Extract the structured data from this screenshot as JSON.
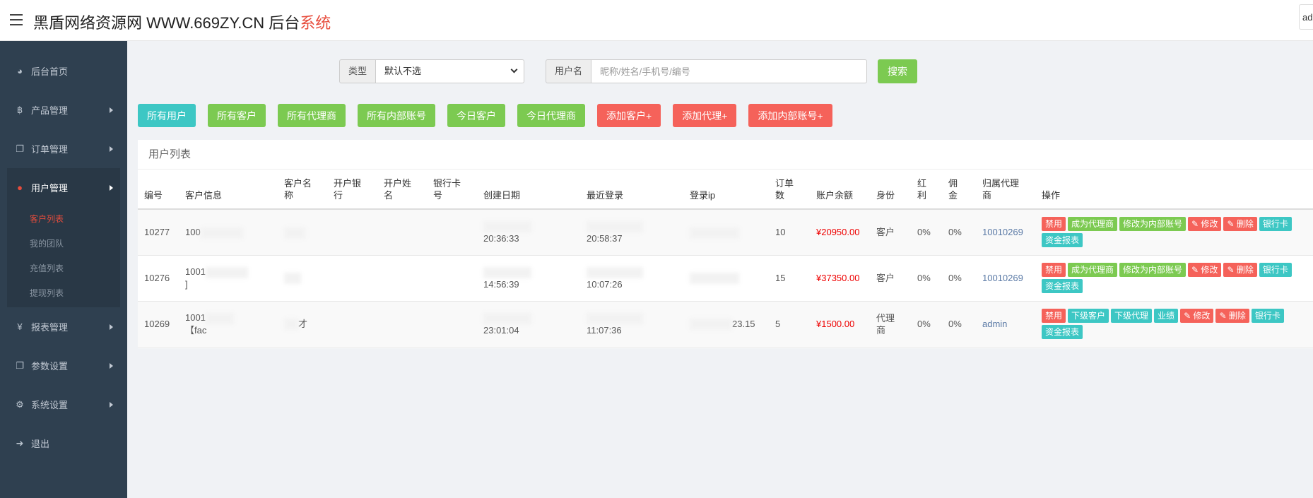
{
  "header": {
    "brand": "黑盾网络资源网 WWW.669ZY.CN 后台",
    "brand_red": "系统",
    "user": "ad"
  },
  "sidebar": {
    "items": [
      {
        "icon": "dashboard-icon",
        "glyph": "◕",
        "label": "后台首页",
        "arrow": false
      },
      {
        "icon": "bitcoin-icon",
        "glyph": "฿",
        "label": "产品管理",
        "arrow": true
      },
      {
        "icon": "copy-icon",
        "glyph": "❐",
        "label": "订单管理",
        "arrow": true
      }
    ],
    "group": {
      "icon": "user-icon",
      "glyph": "●",
      "label": "用户管理",
      "sub": [
        {
          "label": "客户列表",
          "active": true
        },
        {
          "label": "我的团队",
          "active": false
        },
        {
          "label": "充值列表",
          "active": false
        },
        {
          "label": "提现列表",
          "active": false
        }
      ]
    },
    "items_after": [
      {
        "icon": "yen-icon",
        "glyph": "¥",
        "label": "报表管理",
        "arrow": true
      },
      {
        "icon": "copy-icon",
        "glyph": "❐",
        "label": "参数设置",
        "arrow": true
      },
      {
        "icon": "cogs-icon",
        "glyph": "⚙",
        "label": "系统设置",
        "arrow": true
      },
      {
        "icon": "sign-out-icon",
        "glyph": "➜",
        "label": "退出",
        "arrow": false
      }
    ]
  },
  "search": {
    "type_label": "类型",
    "type_value": "默认不选",
    "user_label": "用户名",
    "user_placeholder": "昵称/姓名/手机号/编号",
    "button": "搜索"
  },
  "filters": [
    {
      "label": "所有用户",
      "color": "cyan"
    },
    {
      "label": "所有客户",
      "color": "green"
    },
    {
      "label": "所有代理商",
      "color": "green"
    },
    {
      "label": "所有内部账号",
      "color": "green"
    },
    {
      "label": "今日客户",
      "color": "green"
    },
    {
      "label": "今日代理商",
      "color": "green"
    },
    {
      "label": "添加客户+",
      "color": "red"
    },
    {
      "label": "添加代理+",
      "color": "red"
    },
    {
      "label": "添加内部账号+",
      "color": "red"
    }
  ],
  "panel": {
    "title": "用户列表",
    "columns": [
      "编号",
      "客户信息",
      "客户名称",
      "开户银行",
      "开户姓名",
      "银行卡号",
      "创建日期",
      "最近登录",
      "登录ip",
      "订单数",
      "账户余额",
      "身份",
      "红利",
      "佣金",
      "归属代理商",
      "操作"
    ],
    "rows": [
      {
        "id": "10277",
        "info_1": "100",
        "info_2": "",
        "name": "",
        "bank": "",
        "holder": "",
        "card": "",
        "created": "20:36:33",
        "last_login": "20:58:37",
        "ip": "",
        "orders": "10",
        "balance": "¥20950.00",
        "role": "客户",
        "bonus": "0%",
        "commission": "0%",
        "agent": "10010269",
        "ops": [
          {
            "label": "禁用",
            "color": "red",
            "icon": "ban-icon"
          },
          {
            "label": "成为代理商",
            "color": "green",
            "icon": "agent-icon"
          },
          {
            "label": "修改为内部账号",
            "color": "green",
            "icon": "internal-icon"
          },
          {
            "label": "✎ 修改",
            "color": "red",
            "icon": "pencil-icon"
          },
          {
            "label": "✎ 删除",
            "color": "red",
            "icon": "trash-icon"
          },
          {
            "label": "银行卡",
            "color": "cyan",
            "icon": "card-icon"
          },
          {
            "label": "资金报表",
            "color": "cyan",
            "icon": "report-icon"
          }
        ]
      },
      {
        "id": "10276",
        "info_1": "1001",
        "info_2": "]",
        "name": "",
        "bank": "",
        "holder": "",
        "card": "",
        "created": "14:56:39",
        "last_login": "10:07:26",
        "ip": "",
        "orders": "15",
        "balance": "¥37350.00",
        "role": "客户",
        "bonus": "0%",
        "commission": "0%",
        "agent": "10010269",
        "ops": [
          {
            "label": "禁用",
            "color": "red",
            "icon": "ban-icon"
          },
          {
            "label": "成为代理商",
            "color": "green",
            "icon": "agent-icon"
          },
          {
            "label": "修改为内部账号",
            "color": "green",
            "icon": "internal-icon"
          },
          {
            "label": "✎ 修改",
            "color": "red",
            "icon": "pencil-icon"
          },
          {
            "label": "✎ 删除",
            "color": "red",
            "icon": "trash-icon"
          },
          {
            "label": "银行卡",
            "color": "cyan",
            "icon": "card-icon"
          },
          {
            "label": "资金报表",
            "color": "cyan",
            "icon": "report-icon"
          }
        ]
      },
      {
        "id": "10269",
        "info_1": "1001",
        "info_2": "【fac",
        "name": "才",
        "bank": "",
        "holder": "",
        "card": "",
        "created": "23:01:04",
        "last_login": "11:07:36",
        "ip": "23.15",
        "orders": "5",
        "balance": "¥1500.00",
        "role": "代理商",
        "bonus": "0%",
        "commission": "0%",
        "agent": "admin",
        "ops": [
          {
            "label": "禁用",
            "color": "red",
            "icon": "ban-icon"
          },
          {
            "label": "下级客户",
            "color": "cyan",
            "icon": "sub-customer-icon"
          },
          {
            "label": "下级代理",
            "color": "cyan",
            "icon": "sub-agent-icon"
          },
          {
            "label": "业绩",
            "color": "cyan",
            "icon": "performance-icon"
          },
          {
            "label": "✎ 修改",
            "color": "red",
            "icon": "pencil-icon"
          },
          {
            "label": "✎ 删除",
            "color": "red",
            "icon": "trash-icon"
          },
          {
            "label": "银行卡",
            "color": "cyan",
            "icon": "card-icon"
          },
          {
            "label": "资金报表",
            "color": "cyan",
            "icon": "report-icon"
          }
        ]
      }
    ]
  }
}
